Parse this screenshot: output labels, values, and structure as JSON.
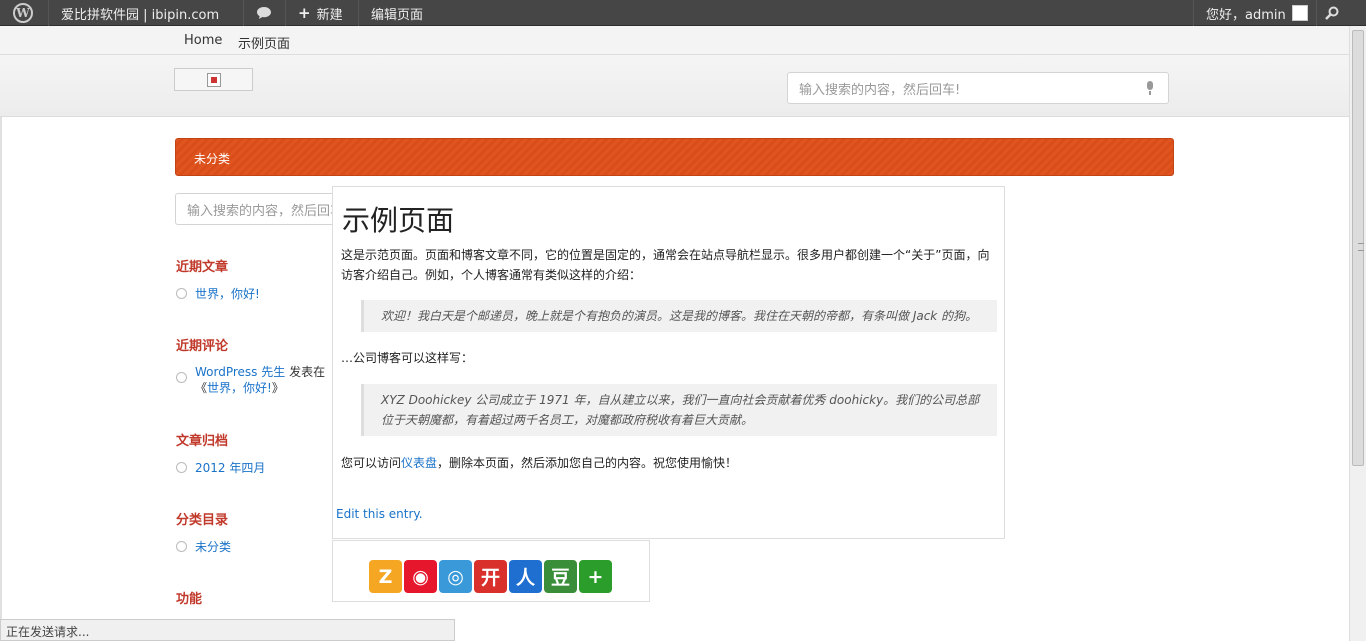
{
  "adminbar": {
    "site_name": "爱比拼软件园 | ibipin.com",
    "new_label": "新建",
    "edit_page_label": "编辑页面",
    "greeting": "您好，admin"
  },
  "topnav": {
    "items": [
      "Home",
      "示例页面"
    ]
  },
  "header": {
    "search_placeholder": "输入搜索的内容，然后回车!"
  },
  "category_bar": {
    "label": "未分类"
  },
  "sidebar": {
    "search_placeholder": "输入搜索的内容，然后回车!",
    "recent_posts": {
      "title": "近期文章",
      "items": [
        "世界，你好!"
      ]
    },
    "recent_comments": {
      "title": "近期评论",
      "author": "WordPress 先生",
      "on_text": "发表在",
      "post_link": "世界，你好!",
      "open_quote": "《",
      "close_quote": "》"
    },
    "archives": {
      "title": "文章归档",
      "items": [
        "2012 年四月"
      ]
    },
    "categories": {
      "title": "分类目录",
      "items": [
        "未分类"
      ]
    },
    "meta": {
      "title": "功能"
    }
  },
  "post": {
    "title": "示例页面",
    "intro": "这是示范页面。页面和博客文章不同，它的位置是固定的，通常会在站点导航栏显示。很多用户都创建一个“关于”页面，向访客介绍自己。例如，个人博客通常有类似这样的介绍：",
    "quote1": "欢迎！我白天是个邮递员，晚上就是个有抱负的演员。这是我的博客。我住在天朝的帝都，有条叫做 Jack 的狗。",
    "middle": "…公司博客可以这样写：",
    "quote2": "XYZ Doohickey 公司成立于 1971 年，自从建立以来，我们一直向社会贡献着优秀 doohicky。我们的公司总部位于天朝魔都，有着超过两千名员工，对魔都政府税收有着巨大贡献。",
    "outro_before": "您可以访问",
    "outro_link": "仪表盘",
    "outro_after": "，删除本页面，然后添加您自己的内容。祝您使用愉快！",
    "edit_link": "Edit this entry."
  },
  "share": {
    "buttons": [
      {
        "icon": "qzone-icon",
        "glyph": "Z",
        "color": "#f5a623"
      },
      {
        "icon": "weibo-icon",
        "glyph": "◉",
        "color": "#e6162d"
      },
      {
        "icon": "tencent-weibo-icon",
        "glyph": "◎",
        "color": "#3a9ad9"
      },
      {
        "icon": "kaixin-icon",
        "glyph": "开",
        "color": "#d9302c"
      },
      {
        "icon": "renren-icon",
        "glyph": "人",
        "color": "#1f6fd1"
      },
      {
        "icon": "douban-icon",
        "glyph": "豆",
        "color": "#3a8e3a"
      },
      {
        "icon": "more-share-icon",
        "glyph": "+",
        "color": "#2a9d2a"
      }
    ]
  },
  "statusbar": {
    "text": "正在发送请求..."
  }
}
